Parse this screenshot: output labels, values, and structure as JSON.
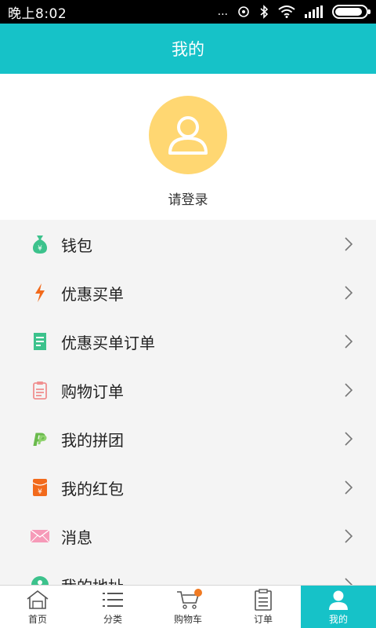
{
  "status_bar": {
    "time": "晚上8:02",
    "dots": "..."
  },
  "header": {
    "title": "我的"
  },
  "profile": {
    "login_label": "请登录"
  },
  "menu": {
    "items": [
      {
        "label": "钱包",
        "icon": "money-bag-icon",
        "color": "#3cc28c"
      },
      {
        "label": "优惠买单",
        "icon": "lightning-icon",
        "color": "#f26a1b"
      },
      {
        "label": "优惠买单订单",
        "icon": "receipt-icon",
        "color": "#3cc28c"
      },
      {
        "label": "购物订单",
        "icon": "clipboard-icon",
        "color": "#f08f8f"
      },
      {
        "label": "我的拼团",
        "icon": "group-buy-icon",
        "color": "#6aba4c"
      },
      {
        "label": "我的红包",
        "icon": "red-envelope-icon",
        "color": "#f26a1b"
      },
      {
        "label": "消息",
        "icon": "envelope-icon",
        "color": "#f69ab8"
      },
      {
        "label": "我的地址",
        "icon": "location-icon",
        "color": "#3cc28c"
      }
    ]
  },
  "bottom_nav": {
    "items": [
      {
        "label": "首页",
        "icon": "home-icon"
      },
      {
        "label": "分类",
        "icon": "list-icon"
      },
      {
        "label": "购物车",
        "icon": "cart-icon"
      },
      {
        "label": "订单",
        "icon": "order-icon"
      },
      {
        "label": "我的",
        "icon": "user-icon",
        "active": true
      }
    ]
  },
  "colors": {
    "accent": "#16c2c8",
    "avatar": "#ffd772",
    "badge": "#f07a22"
  }
}
